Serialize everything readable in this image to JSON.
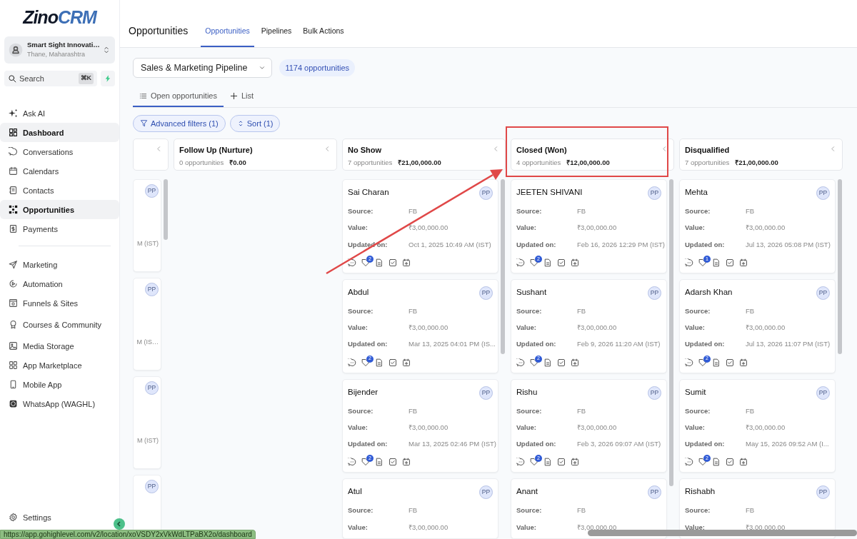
{
  "logo": {
    "dark": "Zino",
    "accent": "CRM"
  },
  "account": {
    "name": "Smart Sight Innovati…",
    "location": "Thane, Maharashtra"
  },
  "search": {
    "placeholder": "Search",
    "shortcut": "⌘K"
  },
  "sidebar": {
    "groups": [
      {
        "items": [
          {
            "label": "Ask AI",
            "highlighted": false
          },
          {
            "label": "Dashboard",
            "highlighted": true
          },
          {
            "label": "Conversations",
            "highlighted": false
          },
          {
            "label": "Calendars",
            "highlighted": false
          },
          {
            "label": "Contacts",
            "highlighted": false
          },
          {
            "label": "Opportunities",
            "highlighted": true
          },
          {
            "label": "Payments",
            "highlighted": false
          }
        ]
      },
      {
        "items": [
          {
            "label": "Marketing",
            "highlighted": false
          },
          {
            "label": "Automation",
            "highlighted": false
          },
          {
            "label": "Funnels & Sites",
            "highlighted": false
          },
          {
            "label": "Courses & Community",
            "highlighted": false
          },
          {
            "label": "Media Storage",
            "highlighted": false
          },
          {
            "label": "App Marketplace",
            "highlighted": false
          },
          {
            "label": "Mobile App",
            "highlighted": false
          },
          {
            "label": "WhatsApp (WAGHL)",
            "highlighted": false
          }
        ]
      }
    ],
    "settings": "Settings"
  },
  "header": {
    "title": "Opportunities",
    "tabs": [
      {
        "label": "Opportunities",
        "selected": true
      },
      {
        "label": "Pipelines",
        "selected": false
      },
      {
        "label": "Bulk Actions",
        "selected": false
      }
    ]
  },
  "pipeline": {
    "value": "Sales & Marketing Pipeline",
    "count": "1174 opportunities"
  },
  "views": [
    {
      "label": "Open opportunities",
      "kind": "list",
      "selected": true
    },
    {
      "label": "List",
      "kind": "add",
      "selected": false
    }
  ],
  "filters": [
    {
      "label": "Advanced filters (1)",
      "kind": "filter"
    },
    {
      "label": "Sort (1)",
      "kind": "sort"
    }
  ],
  "board": {
    "columns": [
      {
        "kind": "clipped-left",
        "cards": [
          {
            "avatar": "PP",
            "fragment": "M (IST)"
          },
          {
            "avatar": "PP",
            "fragment": "M (IS…"
          },
          {
            "avatar": "PP",
            "fragment": "M (IST)"
          },
          {
            "avatar": "PP"
          }
        ]
      },
      {
        "kind": "full",
        "title": "Follow Up (Nurture)",
        "count": "0 opportunities",
        "total": "₹0.00"
      },
      {
        "kind": "full",
        "title": "No Show",
        "count": "7 opportunities",
        "total": "₹21,00,000.00",
        "cards": [
          {
            "name": "Sai Charan",
            "avatar": "PP",
            "fields": [
              {
                "label": "Source:",
                "value": "FB"
              },
              {
                "label": "Value:",
                "value": "₹3,00,000.00"
              },
              {
                "label": "Updated on:",
                "value": "Oct 1, 2025 10:49 AM (IST)"
              }
            ],
            "tag_count": "2"
          },
          {
            "name": "Abdul",
            "avatar": "PP",
            "fields": [
              {
                "label": "Source:",
                "value": "FB"
              },
              {
                "label": "Value:",
                "value": "₹3,00,000.00"
              },
              {
                "label": "Updated on:",
                "value": "Mar 13, 2025 04:01 PM (IS..."
              }
            ],
            "tag_count": "2"
          },
          {
            "name": "Bijender",
            "avatar": "PP",
            "fields": [
              {
                "label": "Source:",
                "value": "FB"
              },
              {
                "label": "Value:",
                "value": "₹3,00,000.00"
              },
              {
                "label": "Updated on:",
                "value": "Mar 13, 2025 02:46 PM (IST)"
              }
            ],
            "tag_count": "2"
          },
          {
            "name": "Atul",
            "avatar": "PP",
            "fields": [
              {
                "label": "Source:",
                "value": "FB"
              },
              {
                "label": "Value:",
                "value": "₹3,00,000.00"
              }
            ]
          }
        ]
      },
      {
        "kind": "full",
        "title": "Closed (Won)",
        "count": "4 opportunities",
        "total": "₹12,00,000.00",
        "cards": [
          {
            "name": "JEETEN SHIVANI",
            "avatar": "PP",
            "fields": [
              {
                "label": "Source:",
                "value": "FB"
              },
              {
                "label": "Value:",
                "value": "₹3,00,000.00"
              },
              {
                "label": "Updated on:",
                "value": "Feb 16, 2026 12:29 PM (IST)"
              }
            ],
            "tag_count": "2"
          },
          {
            "name": "Sushant",
            "avatar": "PP",
            "fields": [
              {
                "label": "Source:",
                "value": "FB"
              },
              {
                "label": "Value:",
                "value": "₹3,00,000.00"
              },
              {
                "label": "Updated on:",
                "value": "Feb 9, 2026 11:20 AM (IST)"
              }
            ],
            "tag_count": "2"
          },
          {
            "name": "Rishu",
            "avatar": "PP",
            "fields": [
              {
                "label": "Source:",
                "value": "FB"
              },
              {
                "label": "Value:",
                "value": "₹3,00,000.00"
              },
              {
                "label": "Updated on:",
                "value": "Feb 3, 2026 09:07 AM (IST)"
              }
            ],
            "tag_count": "2"
          },
          {
            "name": "Anant",
            "avatar": "PP",
            "fields": [
              {
                "label": "Source:",
                "value": "FB"
              },
              {
                "label": "Value:",
                "value": "₹3,00,000.00"
              }
            ]
          }
        ]
      },
      {
        "kind": "full",
        "title": "Disqualified",
        "count": "7 opportunities",
        "total": "₹21,00,000.00",
        "cards": [
          {
            "name": "Mehta",
            "avatar": "PP",
            "fields": [
              {
                "label": "Source:",
                "value": "FB"
              },
              {
                "label": "Value:",
                "value": "₹3,00,000.00"
              },
              {
                "label": "Updated on:",
                "value": "Jul 13, 2026 05:08 PM (IST)"
              }
            ],
            "tag_count": "1"
          },
          {
            "name": "Adarsh Khan",
            "avatar": "PP",
            "fields": [
              {
                "label": "Source:",
                "value": "FB"
              },
              {
                "label": "Value:",
                "value": "₹3,00,000.00"
              },
              {
                "label": "Updated on:",
                "value": "Jul 13, 2026 11:07 PM (IST)"
              }
            ],
            "tag_count": "2"
          },
          {
            "name": "Sumit",
            "avatar": "PP",
            "fields": [
              {
                "label": "Source:",
                "value": "FB"
              },
              {
                "label": "Value:",
                "value": "₹3,00,000.00"
              },
              {
                "label": "Updated on:",
                "value": "May 15, 2026 09:52 AM (I..."
              }
            ],
            "tag_count": "2"
          },
          {
            "name": "Rishabh",
            "avatar": "PP",
            "fields": [
              {
                "label": "Source:",
                "value": "FB"
              },
              {
                "label": "Value:",
                "value": "₹3,00,000.00"
              }
            ]
          }
        ]
      }
    ]
  },
  "status_url": "https://app.gohighlevel.com/v2/location/xoVSDY2xVkWdLTPaBX2o/dashboard"
}
